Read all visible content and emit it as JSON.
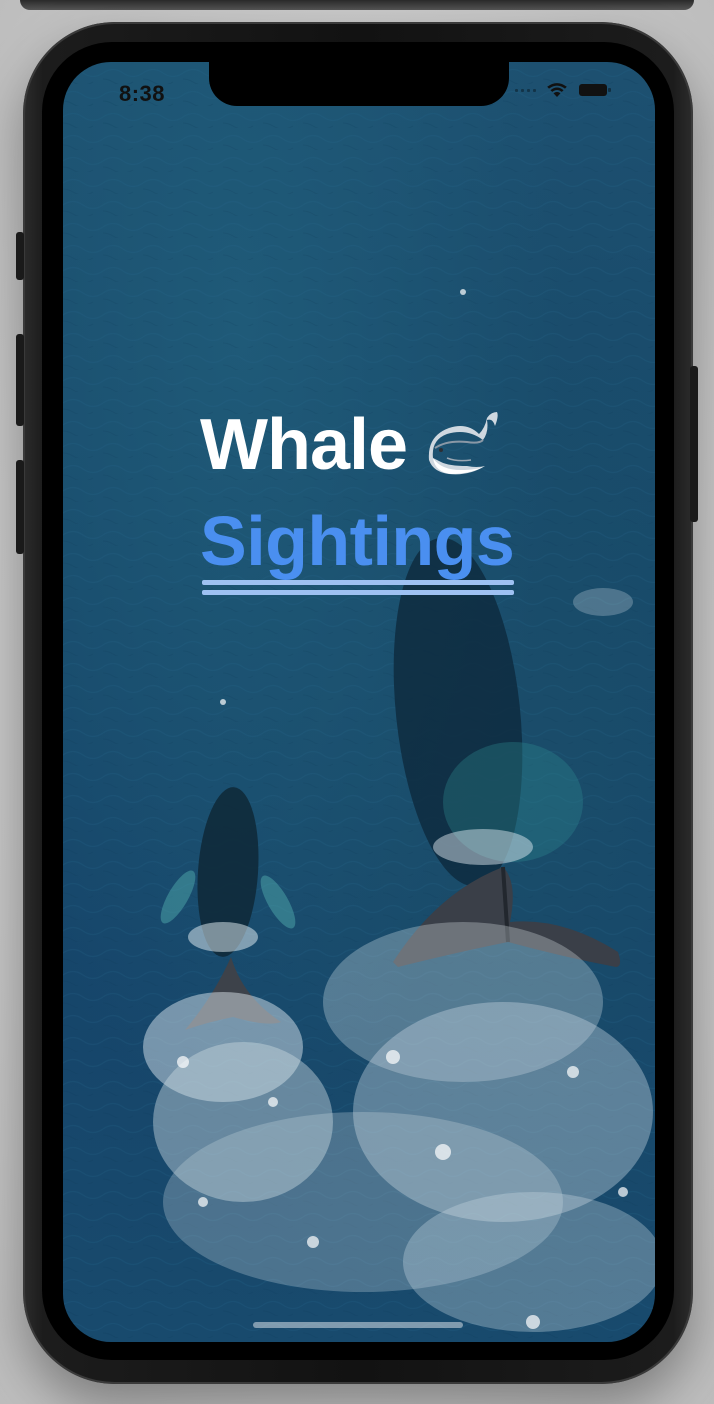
{
  "status_bar": {
    "time": "8:38",
    "icons": [
      "cellular-signal-icon",
      "wifi-icon",
      "battery-icon"
    ]
  },
  "title": {
    "line1": "Whale",
    "line1_emoji": "whale-emoji",
    "line2": "Sightings"
  },
  "background": {
    "subject": "aerial-ocean-photo-with-whales"
  },
  "colors": {
    "title_white": "#ffffff",
    "link_blue": "#4a8ff0",
    "underline_blue": "#9ec1f2",
    "ocean_blue": "#1a4c6c"
  }
}
